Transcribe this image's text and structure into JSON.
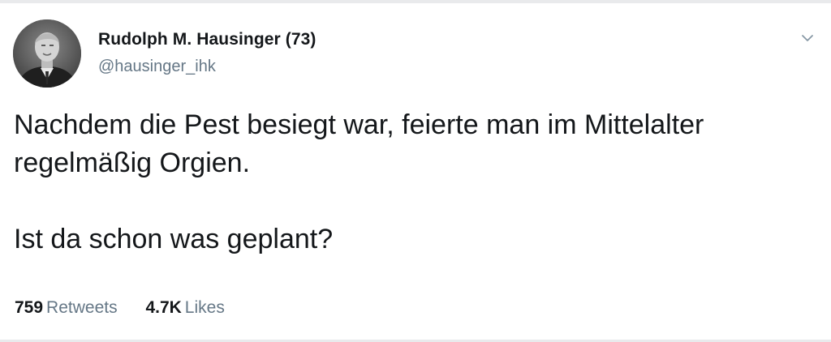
{
  "tweet": {
    "author": {
      "display_name": "Rudolph M. Hausinger (73)",
      "handle": "@hausinger_ihk"
    },
    "text_lines": [
      "Nachdem die Pest besiegt war, feierte man im Mittelalter",
      "regelmäßig Orgien.",
      "Ist da schon was geplant?"
    ],
    "stats": {
      "retweets_count": "759",
      "retweets_label": "Retweets",
      "likes_count": "4.7K",
      "likes_label": "Likes"
    }
  },
  "icons": {
    "menu": "chevron-down-icon",
    "avatar": "user-photo"
  },
  "colors": {
    "text_primary": "#14171a",
    "text_secondary": "#657786",
    "divider": "#e9eaec"
  }
}
